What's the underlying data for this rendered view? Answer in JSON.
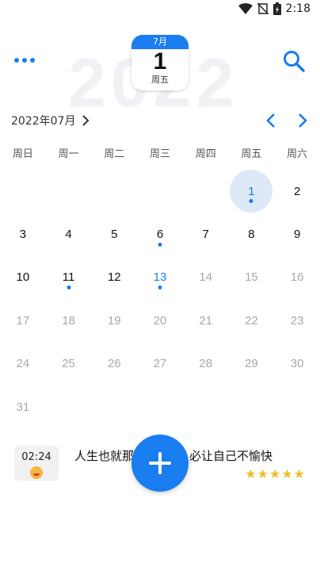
{
  "status_bar": {
    "time": "2:18"
  },
  "header": {
    "watermark_year": "2022",
    "date_card": {
      "month": "7月",
      "day": "1",
      "weekday": "周五"
    }
  },
  "month_nav": {
    "label": "2022年07月"
  },
  "weekdays": [
    "周日",
    "周一",
    "周二",
    "周三",
    "周四",
    "周五",
    "周六"
  ],
  "calendar_rows": [
    [
      "",
      "",
      "",
      "",
      "",
      "1",
      "2"
    ],
    [
      "3",
      "4",
      "5",
      "6",
      "7",
      "8",
      "9"
    ],
    [
      "10",
      "11",
      "12",
      "13",
      "14",
      "15",
      "16"
    ],
    [
      "17",
      "18",
      "19",
      "20",
      "21",
      "22",
      "23"
    ],
    [
      "24",
      "25",
      "26",
      "27",
      "28",
      "29",
      "30"
    ],
    [
      "31",
      "",
      "",
      "",
      "",
      "",
      ""
    ]
  ],
  "entry": {
    "time": "02:24",
    "text": "人生也就那么…必让自己不愉快",
    "text_left": "人生也就那",
    "text_right": "必让自己不愉快",
    "rating": 5,
    "stars": "★★★★★"
  },
  "colors": {
    "accent": "#1a7df0",
    "muted": "#a8a8a8",
    "selected_bg": "#dde9f7",
    "star": "#f1be2b"
  }
}
